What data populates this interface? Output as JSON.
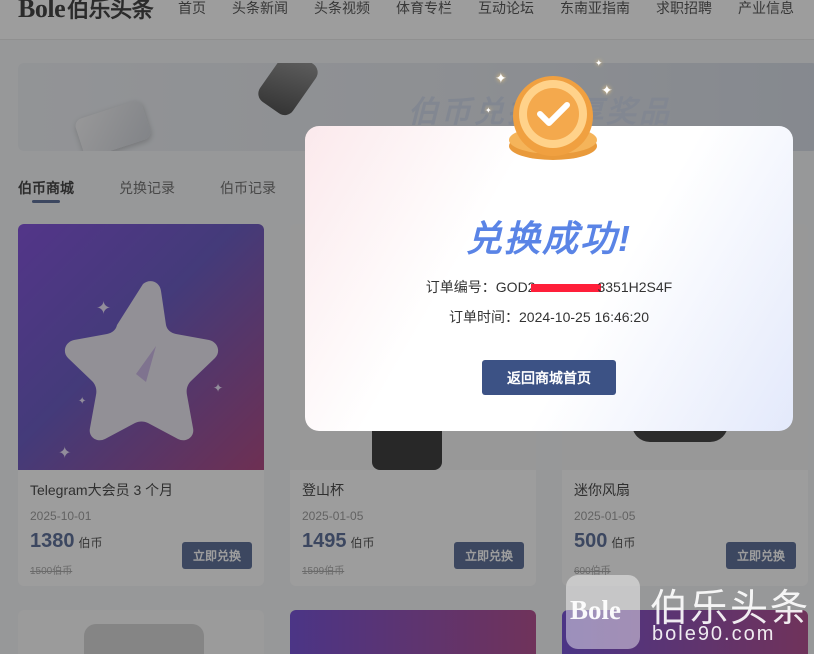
{
  "header": {
    "logo": "Bole",
    "logo_cn": "伯乐头条",
    "nav": [
      "首页",
      "头条新闻",
      "头条视频",
      "体育专栏",
      "互动论坛",
      "东南亚指南",
      "求职招聘",
      "产业信息"
    ]
  },
  "banner": {
    "text": "伯币兑换丰厚奖品"
  },
  "tabs": [
    "伯币商城",
    "兑换记录",
    "伯币记录"
  ],
  "cards": [
    {
      "title": "Telegram大会员 3 个月",
      "date": "2025-10-01",
      "price": "1380",
      "unit": "伯币",
      "old_price": "1500伯币",
      "button": "立即兑换"
    },
    {
      "title": "登山杯",
      "date": "2025-01-05",
      "price": "1495",
      "unit": "伯币",
      "old_price": "1599伯币",
      "button": "立即兑换"
    },
    {
      "title": "迷你风扇",
      "date": "2025-01-05",
      "price": "500",
      "unit": "伯币",
      "old_price": "600伯币",
      "button": "立即兑换"
    }
  ],
  "modal": {
    "title": "兑换成功!",
    "order_no_label": "订单编号：",
    "order_no_prefix": "GOD2",
    "order_no_suffix": "3351H2S4F",
    "order_time_label": "订单时间：",
    "order_time": "2024-10-25 16:46:20",
    "button": "返回商城首页"
  },
  "watermark": {
    "logo": "Bole",
    "cn": "伯乐头条",
    "url": "bole90.com"
  },
  "colors": {
    "primary": "#3c5285",
    "title_blue": "#5a84e6",
    "redaction": "#ff1f3a"
  }
}
